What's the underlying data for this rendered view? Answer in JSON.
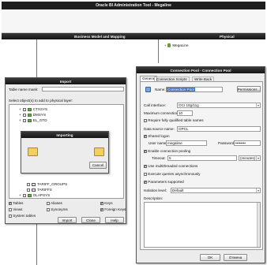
{
  "app": {
    "title": "Oracle BI Administration Tool - Megaline",
    "panes": {
      "left_header": "",
      "middle_header": "Business Model and Mapping",
      "right_header": "Physical"
    },
    "physical_tree_item": "MegaLine"
  },
  "import_dialog": {
    "title": "Import",
    "table_name_mask_label": "Table name mask:",
    "select_objects_label": "Select object(s) to add to physical layer:",
    "tree_items": [
      "CTXSYS",
      "DMSYS",
      "EL_GTD"
    ],
    "tree_items_bottom": [
      "TARIFF_GROUPS",
      "TARIFFS",
      "OLAPSYS"
    ],
    "checkboxes": [
      {
        "label": "Tables",
        "checked": true
      },
      {
        "label": "Aliases",
        "checked": false
      },
      {
        "label": "Keys",
        "checked": true
      },
      {
        "label": "Views",
        "checked": false
      },
      {
        "label": "Synonyms",
        "checked": false
      },
      {
        "label": "Foreign Keys",
        "checked": true
      },
      {
        "label": "System tables",
        "checked": false
      }
    ],
    "buttons": {
      "import": "Import",
      "close": "Close",
      "help": "Help"
    }
  },
  "importing_dialog": {
    "title": "Importing",
    "cancel": "Cancel"
  },
  "pool_dialog": {
    "title": "Connection Pool - Connection Pool",
    "tabs": [
      "General",
      "Connection Scripts",
      "Write Back"
    ],
    "name_label": "Name:",
    "name_value": "Connection Pool",
    "permissions_button": "Permissions...",
    "call_interface_label": "Call interface:",
    "call_interface_value": "OCI 10g/11g",
    "max_connections_label": "Maximum connections:",
    "max_connections_value": "10",
    "require_qualified_label": "Require fully qualified table names",
    "data_source_label": "Data source name:",
    "data_source_value": "OPCL",
    "shared_logon_label": "Shared logon",
    "user_name_label": "User name:",
    "user_name_value": "megaline",
    "password_label": "Password:",
    "password_value": "••••••••",
    "enable_pooling_label": "Enable connection pooling",
    "timeout_label": "Timeout:",
    "timeout_value": "5",
    "timeout_unit": "(minutes)",
    "multithreaded_label": "Use multithreaded connections",
    "async_label": "Execute queries asynchronously",
    "parameters_label": "Parameters supported",
    "isolation_label": "Isolation level:",
    "isolation_value": "Default",
    "description_label": "Description:",
    "ok_button": "OK",
    "cancel_button": "Отмена"
  }
}
